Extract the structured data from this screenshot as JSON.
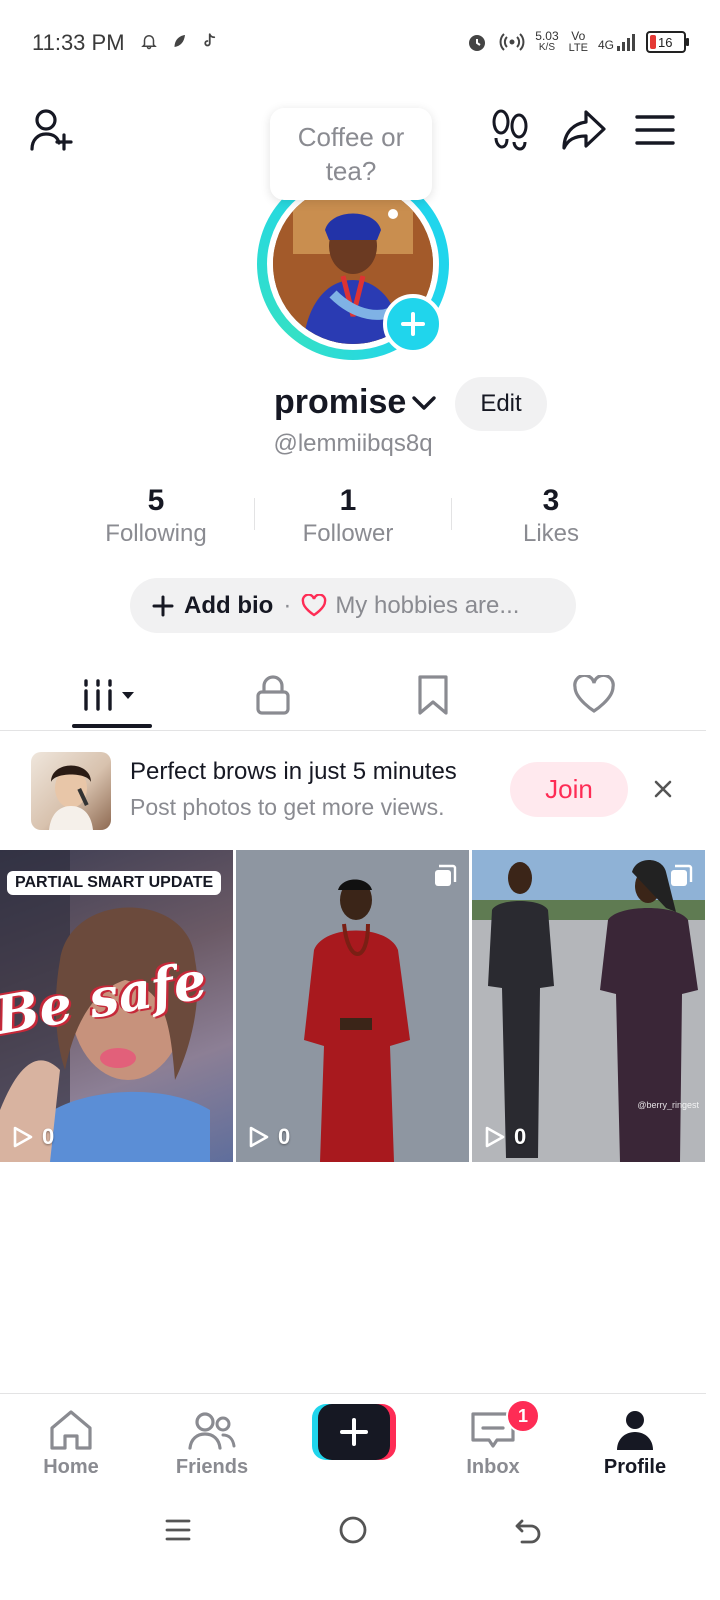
{
  "status_bar": {
    "time": "11:33 PM",
    "speed_value": "5.03",
    "speed_unit": "K/S",
    "volte_top": "Vo",
    "volte_bottom": "LTE",
    "network": "4G",
    "battery": "16",
    "colors": {
      "battery_low": "#e53935"
    }
  },
  "top_bar": {
    "bubble_text": "Coffee or tea?",
    "icons": [
      "add-friend-icon",
      "footprints-icon",
      "share-icon",
      "menu-icon"
    ]
  },
  "profile": {
    "display_name": "promise",
    "edit_label": "Edit",
    "handle": "@lemmiibqs8q",
    "stats": [
      {
        "value": "5",
        "label": "Following"
      },
      {
        "value": "1",
        "label": "Follower"
      },
      {
        "value": "3",
        "label": "Likes"
      }
    ],
    "bio_add_label": "Add bio",
    "bio_separator": "·",
    "bio_hint": "My hobbies are..."
  },
  "tabs": {
    "items": [
      "videos-grid-icon",
      "private-lock-icon",
      "favorites-bookmark-icon",
      "liked-heart-icon"
    ]
  },
  "promo": {
    "title": "Perfect brows in just 5 minutes",
    "subtitle": "Post photos to get more views.",
    "join_label": "Join"
  },
  "videos": [
    {
      "badge": "PARTIAL SMART UPDATE",
      "overlay_text": "Be safe",
      "views": "0"
    },
    {
      "views": "0"
    },
    {
      "watermark": "@berry_ringest",
      "views": "0"
    }
  ],
  "bottom_nav": {
    "items": [
      {
        "label": "Home",
        "icon": "home-icon"
      },
      {
        "label": "Friends",
        "icon": "friends-icon"
      },
      {
        "label": "",
        "icon": "create-plus-icon"
      },
      {
        "label": "Inbox",
        "icon": "inbox-icon",
        "badge": "1"
      },
      {
        "label": "Profile",
        "icon": "profile-icon"
      }
    ],
    "colors": {
      "accent_red": "#fe2c55",
      "accent_cyan": "#20d5ec"
    }
  }
}
